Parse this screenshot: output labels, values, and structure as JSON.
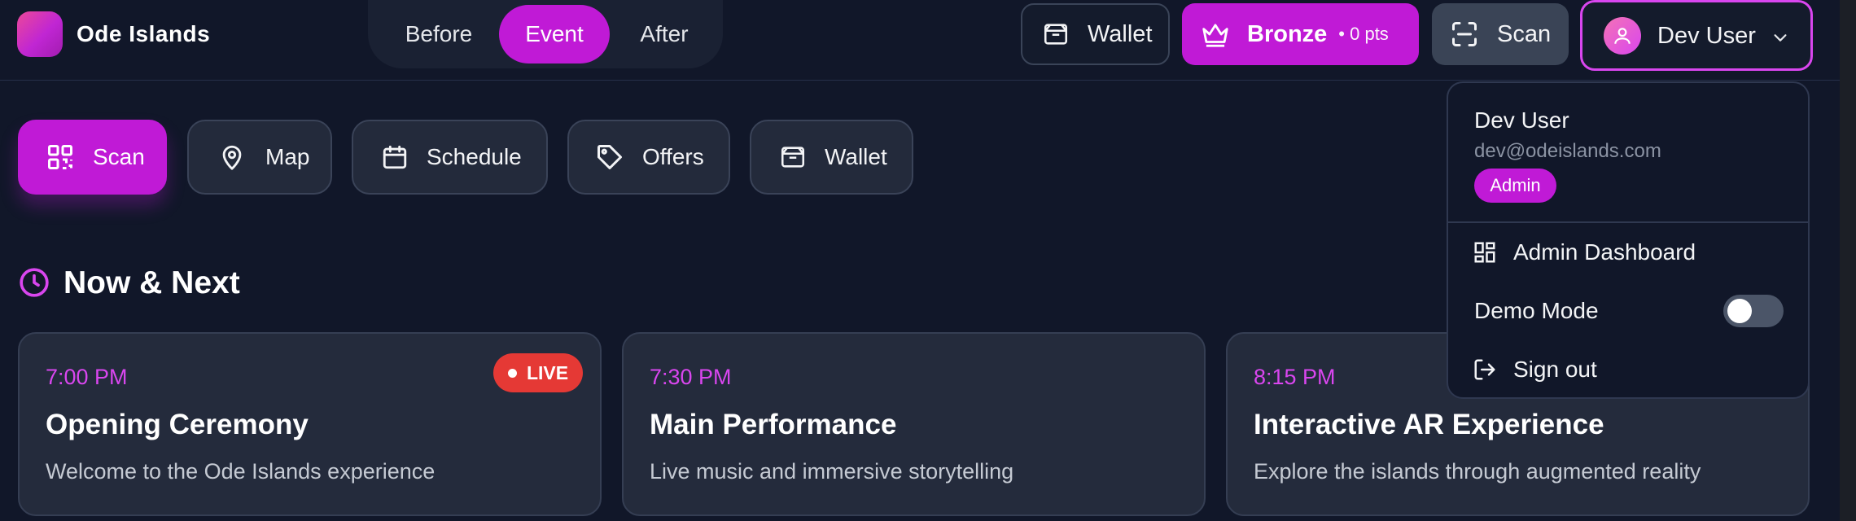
{
  "app": {
    "name": "Ode Islands"
  },
  "phase_tabs": [
    {
      "label": "Before",
      "active": false
    },
    {
      "label": "Event",
      "active": true
    },
    {
      "label": "After",
      "active": false
    }
  ],
  "header_actions": {
    "wallet_label": "Wallet",
    "tier_label": "Bronze",
    "points_label": "• 0 pts",
    "scan_label": "Scan",
    "user_name": "Dev User"
  },
  "quick_actions": [
    {
      "label": "Scan",
      "icon": "qr-code-icon",
      "primary": true
    },
    {
      "label": "Map",
      "icon": "map-pin-icon"
    },
    {
      "label": "Schedule",
      "icon": "calendar-icon"
    },
    {
      "label": "Offers",
      "icon": "tag-icon"
    },
    {
      "label": "Wallet",
      "icon": "wallet-icon"
    }
  ],
  "now_next": {
    "title": "Now & Next",
    "cards": [
      {
        "time": "7:00 PM",
        "title": "Opening Ceremony",
        "description": "Welcome to the Ode Islands experience",
        "badge": "LIVE"
      },
      {
        "time": "7:30 PM",
        "title": "Main Performance",
        "description": "Live music and immersive storytelling"
      },
      {
        "time": "8:15 PM",
        "title": "Interactive AR Experience",
        "description": "Explore the islands through augmented reality"
      }
    ]
  },
  "user_menu": {
    "name": "Dev User",
    "email": "dev@odeislands.com",
    "role": "Admin",
    "items": [
      {
        "label": "Admin Dashboard",
        "icon": "dashboard-icon"
      },
      {
        "label": "Demo Mode",
        "toggle": false
      },
      {
        "label": "Sign out",
        "icon": "sign-out-icon"
      }
    ]
  },
  "colors": {
    "background": "#111729",
    "accent": "#c01ad6",
    "card": "#242b3c",
    "live": "#e53935"
  }
}
